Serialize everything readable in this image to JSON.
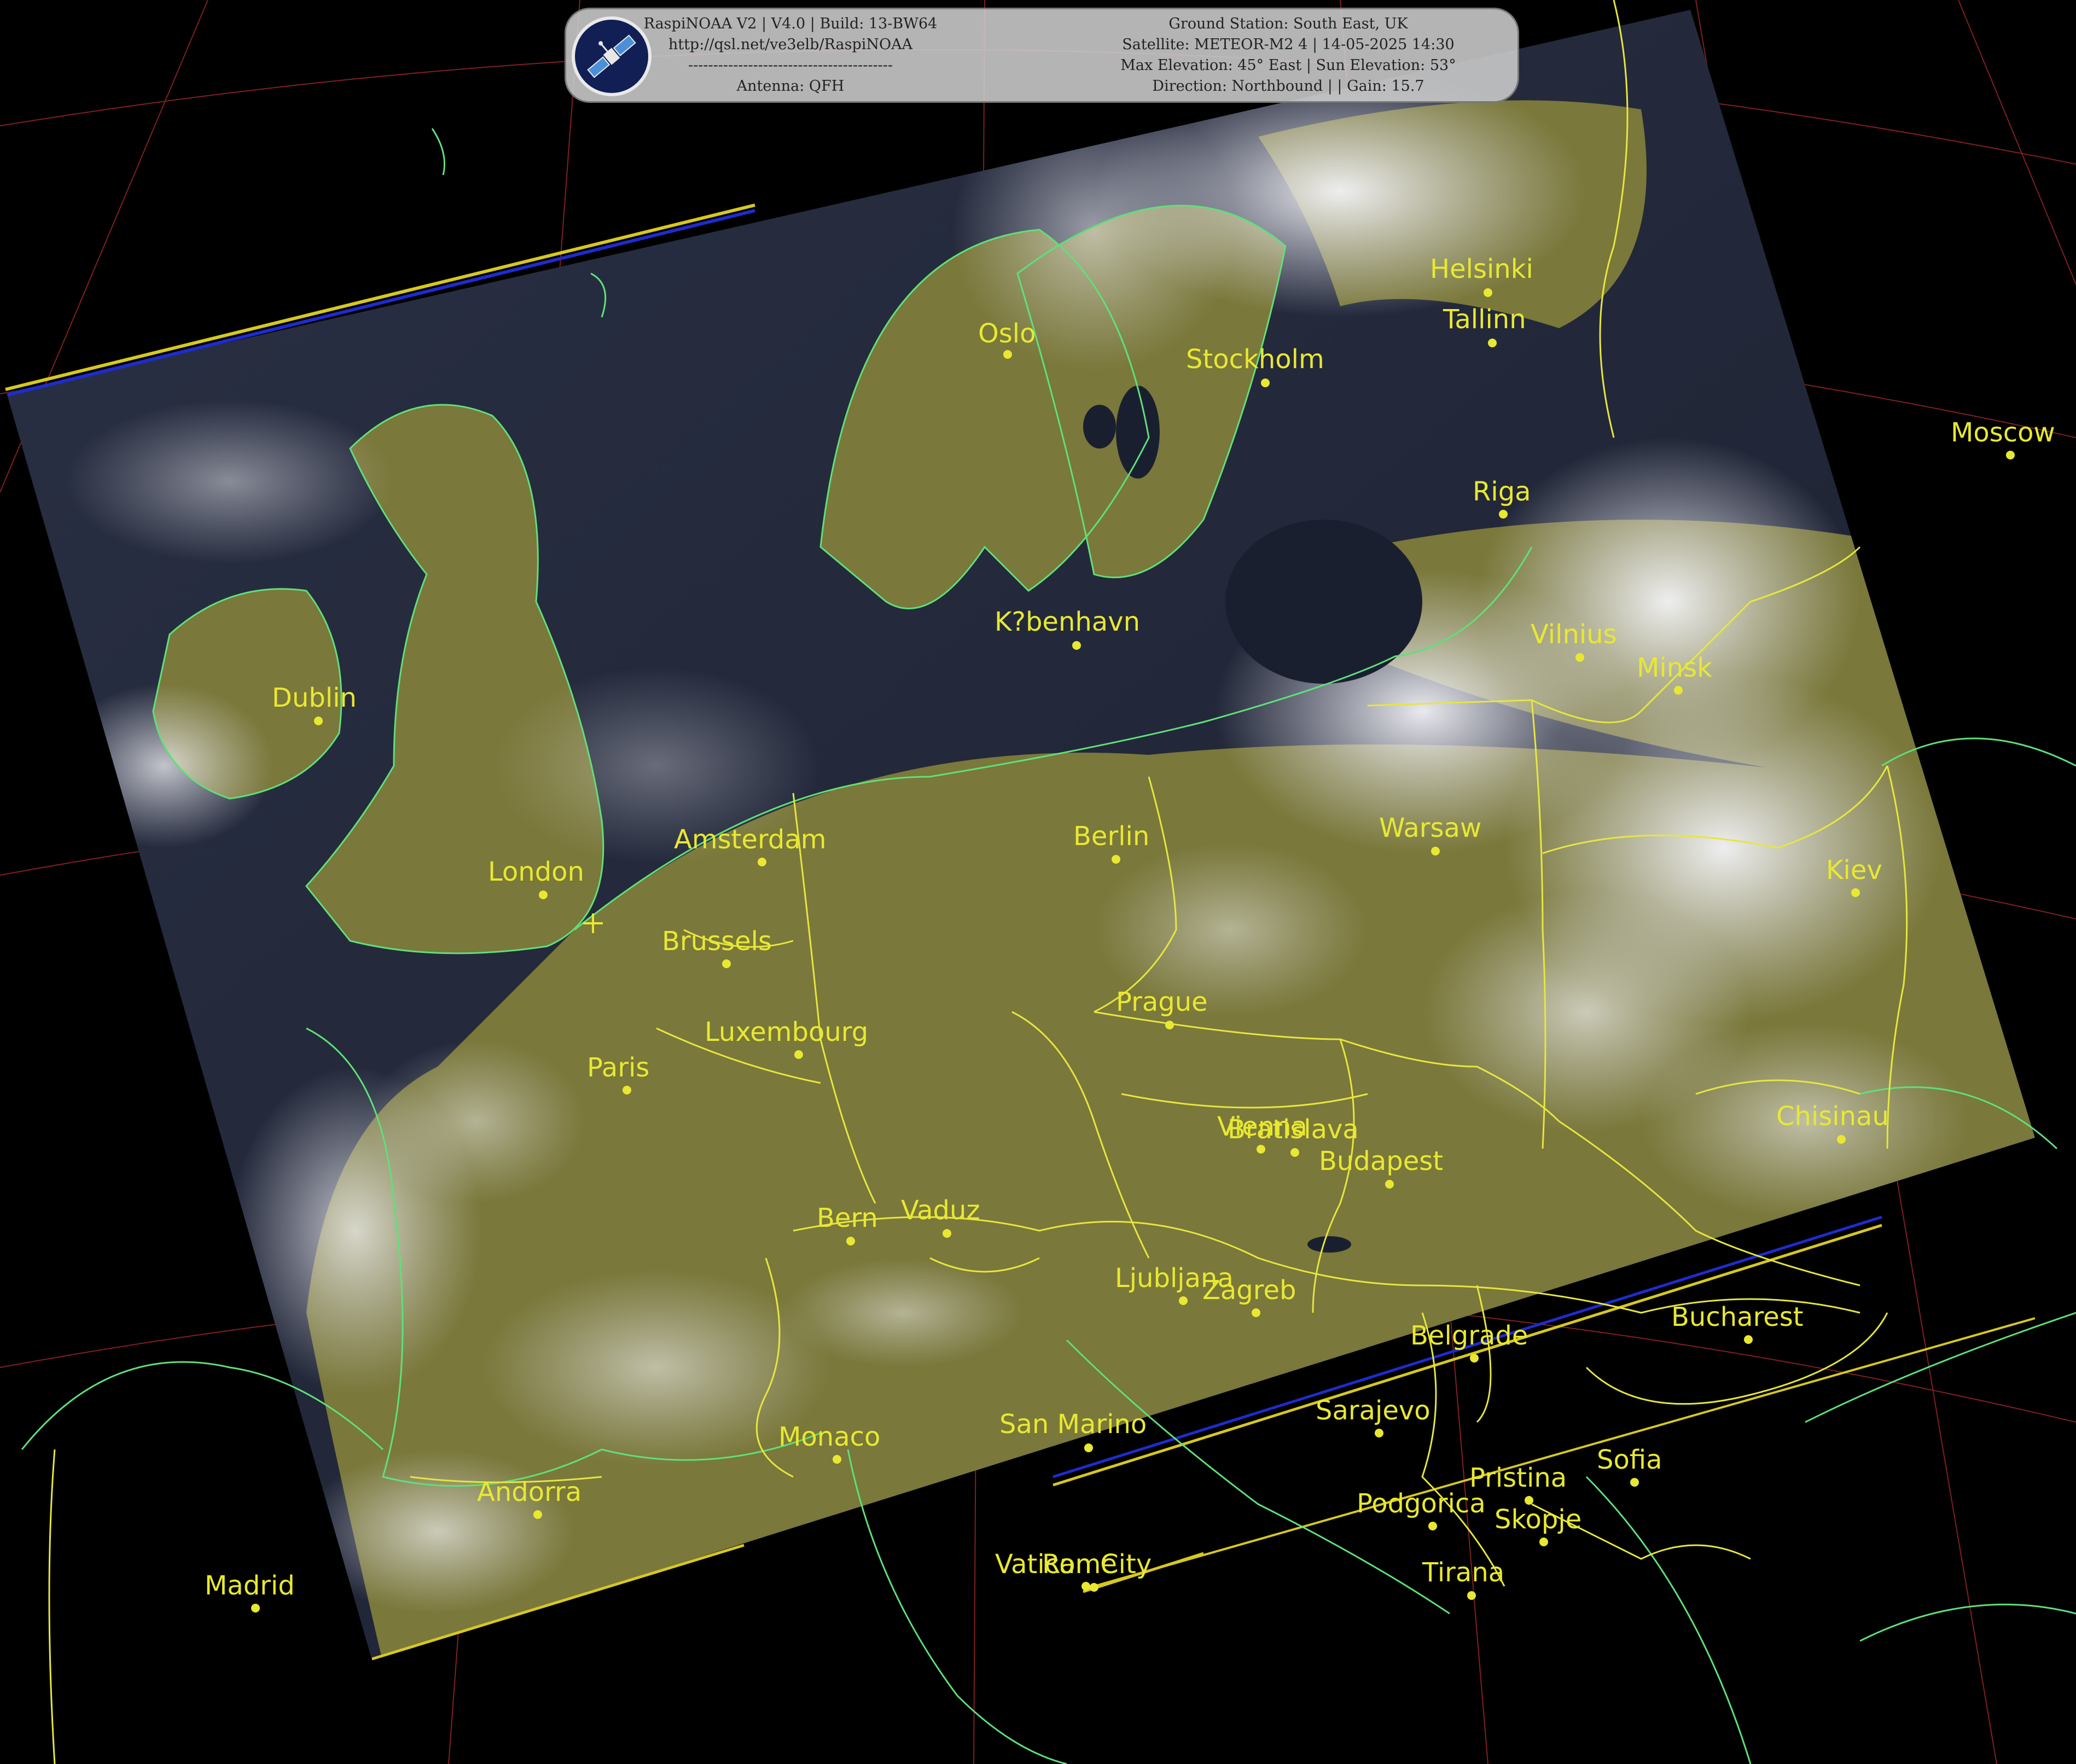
{
  "header": {
    "software_line": "RaspiNOAA V2 | V4.0 | Build: 13-BW64",
    "url_line": "http://qsl.net/ve3elb/RaspiNOAA",
    "divider_line": "-----------------------------------------",
    "antenna_line": "Antenna: QFH",
    "station_line": "Ground Station: South East, UK",
    "satellite_line": "Satellite: METEOR-M2 4 | 14-05-2025 14:30",
    "elevation_line": "Max Elevation: 45° East | Sun Elevation: 53°",
    "direction_line": "Direction: Northbound | | Gain: 15.7"
  },
  "cities": [
    {
      "name": "Oslo"
    },
    {
      "name": "Stockholm"
    },
    {
      "name": "Helsinki"
    },
    {
      "name": "Tallinn"
    },
    {
      "name": "Riga"
    },
    {
      "name": "Moscow"
    },
    {
      "name": "K?benhavn"
    },
    {
      "name": "Vilnius"
    },
    {
      "name": "Minsk"
    },
    {
      "name": "Dublin"
    },
    {
      "name": "Amsterdam"
    },
    {
      "name": "Berlin"
    },
    {
      "name": "Warsaw"
    },
    {
      "name": "London"
    },
    {
      "name": "Kiev"
    },
    {
      "name": "Brussels"
    },
    {
      "name": "Prague"
    },
    {
      "name": "Luxembourg"
    },
    {
      "name": "Paris"
    },
    {
      "name": "Chisinau"
    },
    {
      "name": "Vienna"
    },
    {
      "name": "Bratislava"
    },
    {
      "name": "Budapest"
    },
    {
      "name": "Bern"
    },
    {
      "name": "Vaduz"
    },
    {
      "name": "Ljubljana"
    },
    {
      "name": "Zagreb"
    },
    {
      "name": "Bucharest"
    },
    {
      "name": "Belgrade"
    },
    {
      "name": "Sarajevo"
    },
    {
      "name": "Monaco"
    },
    {
      "name": "San Marino"
    },
    {
      "name": "Pristina"
    },
    {
      "name": "Sofia"
    },
    {
      "name": "Podgorica"
    },
    {
      "name": "Skopje"
    },
    {
      "name": "Andorra"
    },
    {
      "name": "Madrid"
    },
    {
      "name": "Vatican City"
    },
    {
      "name": "Rome"
    },
    {
      "name": "Tirana"
    }
  ],
  "colors": {
    "background": "#000000",
    "coastline": "#5fe07a",
    "border": "#e6e640",
    "city_label": "#e8e832",
    "graticule": "#b03030",
    "land": "#7c7a3a",
    "sea": "#1c2236",
    "cloud": "#e8e8ee"
  }
}
